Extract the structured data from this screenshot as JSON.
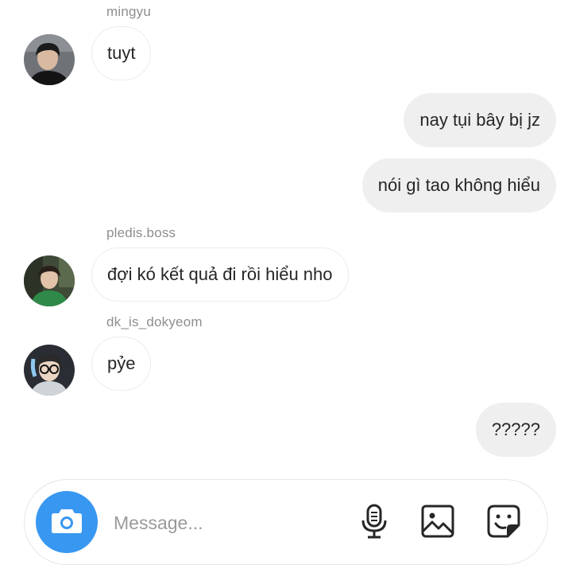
{
  "messages": [
    {
      "type": "incoming",
      "sender": "mingyu",
      "text": "tuyt",
      "avatar": "avatar-mingyu"
    },
    {
      "type": "outgoing",
      "text": "nay tụi bây bị jz"
    },
    {
      "type": "outgoing",
      "text": "nói gì tao không hiểu"
    },
    {
      "type": "incoming",
      "sender": "pledis.boss",
      "text": "đợi kó kết quả đi rồi hiểu nho",
      "avatar": "avatar-pledis-boss"
    },
    {
      "type": "incoming",
      "sender": "dk_is_dokyeom",
      "text": "pỷe",
      "avatar": "avatar-dk-is-dokyeom"
    },
    {
      "type": "outgoing",
      "text": "?????"
    }
  ],
  "composer": {
    "placeholder": "Message...",
    "icons": [
      "camera-icon",
      "microphone-icon",
      "gallery-icon",
      "sticker-icon"
    ]
  },
  "colors": {
    "accent": "#3897f0",
    "outgoing_bubble": "#efefef",
    "incoming_border": "#ececec",
    "sender_name": "#8e8e8e",
    "text": "#262626"
  }
}
